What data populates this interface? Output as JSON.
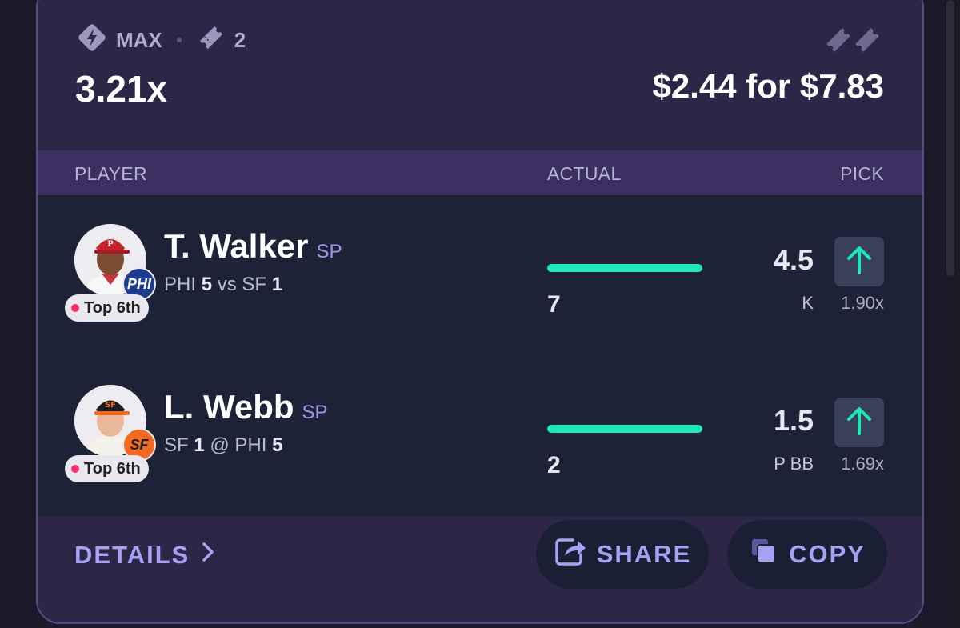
{
  "header": {
    "mode_icon": "lightning-diamond-icon",
    "mode_label": "MAX",
    "entry_icon": "ticket-icon",
    "entry_count": "2",
    "multiplier": "3.21x",
    "payout": "$2.44 for $7.83",
    "corner_icon": "double-ticket-icon"
  },
  "columns": {
    "player": "PLAYER",
    "actual": "ACTUAL",
    "pick": "PICK"
  },
  "players": [
    {
      "name": "T. Walker",
      "position": "SP",
      "team_badge": "PHI",
      "team_color": "#1d3b8f",
      "status": "Top 6th",
      "game_team": "PHI",
      "game_team_score": "5",
      "game_sep": "vs",
      "game_opp": "SF",
      "game_opp_score": "1",
      "actual": "7",
      "progress": 1.0,
      "line": "4.5",
      "stat": "K",
      "multiplier": "1.90x",
      "pick_icon": "arrow-up-icon"
    },
    {
      "name": "L. Webb",
      "position": "SP",
      "team_badge": "SF",
      "team_color": "#f26a22",
      "status": "Top 6th",
      "game_team": "SF",
      "game_team_score": "1",
      "game_sep": "@",
      "game_opp": "PHI",
      "game_opp_score": "5",
      "actual": "2",
      "progress": 1.0,
      "line": "1.5",
      "stat": "P BB",
      "multiplier": "1.69x",
      "pick_icon": "arrow-up-icon"
    }
  ],
  "footer": {
    "details_label": "DETAILS",
    "share_label": "SHARE",
    "copy_label": "COPY"
  },
  "colors": {
    "accent": "#1ce9b6",
    "link": "#a6a1f3",
    "live": "#ff2b6b"
  }
}
